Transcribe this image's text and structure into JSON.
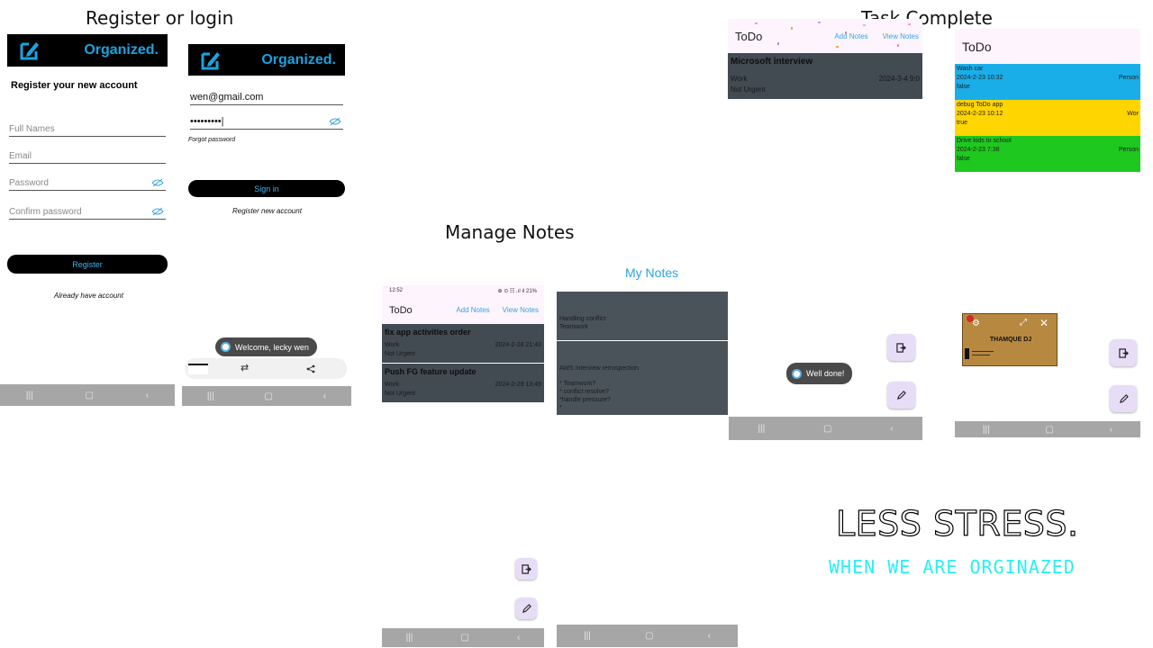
{
  "headings": {
    "register_or_login": "Register or login",
    "task_complete": "Task Complete",
    "manage_notes": "Manage Notes",
    "my_notes": "My Notes"
  },
  "brand": {
    "name": "Organized.",
    "accent": "#1aa3e0",
    "icon": "edit-note-icon"
  },
  "register": {
    "title": "Register your new account",
    "full_names_placeholder": "Full Names",
    "email_placeholder": "Email",
    "password_placeholder": "Password",
    "confirm_password_placeholder": "Confirm password",
    "register_button": "Register",
    "have_account_link": "Already have account"
  },
  "login": {
    "email_value": "wen@gmail.com",
    "password_value": "•••••••••",
    "forgot_password": "Forgot password",
    "sign_in_button": "Sign in",
    "register_link": "Register new account",
    "toast": "Welcome, lecky wen"
  },
  "todo_app": {
    "title": "ToDo",
    "add_notes": "Add Notes",
    "view_notes": "View Notes",
    "status_time": "12:52",
    "status_icons": "⊕ ⊙ ☷ .ıl ıl 21%",
    "tasks": [
      {
        "title": "fix app activities order",
        "category": "Work",
        "date": "2024-2-28 21:43",
        "urgency": "Not Urgent"
      },
      {
        "title": "Push FG feature update",
        "category": "Work",
        "date": "2024-2-29 13:49",
        "urgency": "Not Urgent"
      }
    ]
  },
  "notes": [
    {
      "title": "Handling conflict",
      "body": "Teamwork"
    },
    {
      "title": "AWS Interview  retrospection",
      "body1": "* Teamwork?",
      "body2": "* conflict resolve?",
      "body3": "*handle pressure?",
      "body4": "*"
    }
  ],
  "task_complete": {
    "task": {
      "title": "Microsoft interview",
      "category": "Work",
      "date": "2024-3-4 9:0",
      "urgency": "Not Urgent"
    },
    "toast": "Well done!"
  },
  "colored_tasks": [
    {
      "title": "Wash car",
      "date": "2024-2-23 10:32",
      "category": "Person",
      "done": "false",
      "color": "#1aaee8"
    },
    {
      "title": "debug ToDo app",
      "date": "2024-2-23 10:12",
      "category": "Wor",
      "done": "true",
      "color": "#ffd500"
    },
    {
      "title": "Drive kids to school",
      "date": "2024-2-23 7:38",
      "category": "Person",
      "done": "false",
      "color": "#1ec81e"
    }
  ],
  "popup": {
    "name": "THAMQUE DJ"
  },
  "tagline": {
    "line1": "LESS STRESS.",
    "line2": "WHEN WE ARE ORGINAZED"
  },
  "colors": {
    "navbar": "#a6a6a6",
    "card": "#424a52",
    "fab": "#e7ddf7",
    "link": "#3aa3dd",
    "cyan": "#2af0f0"
  }
}
